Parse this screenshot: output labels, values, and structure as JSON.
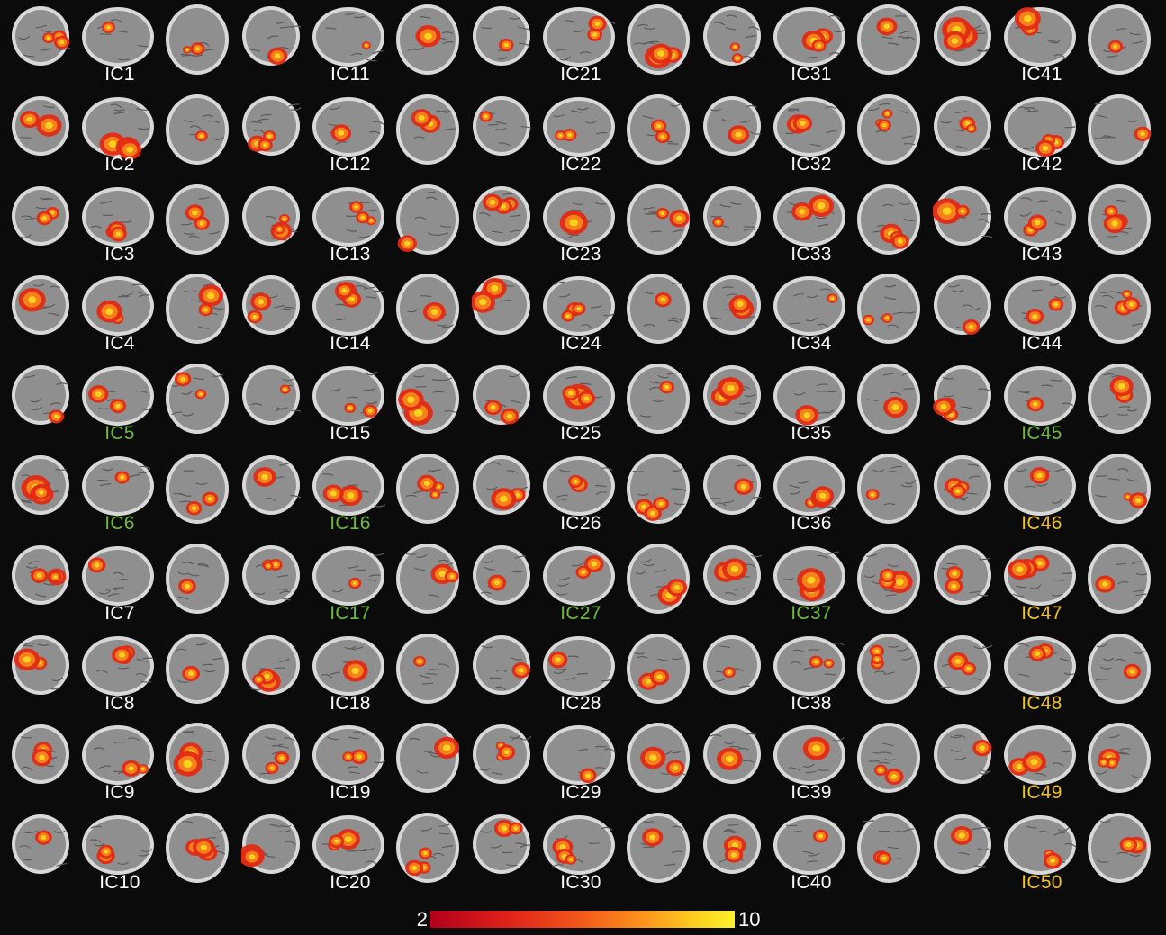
{
  "colors": {
    "background": "#0b0b0b",
    "label_default": "#ffffff",
    "label_green": "#6dbb3c",
    "label_yellow": "#f2c21b",
    "skull": "#d8d8d8",
    "tissue": "#8f8f8f"
  },
  "colorbar": {
    "min": "2",
    "max": "10",
    "colors": [
      "#b3001a",
      "#e0201a",
      "#f25a1a",
      "#ff9a1e",
      "#ffd21e",
      "#fff12a"
    ]
  },
  "components": [
    {
      "label": "IC1",
      "color": "white"
    },
    {
      "label": "IC2",
      "color": "white"
    },
    {
      "label": "IC3",
      "color": "white"
    },
    {
      "label": "IC4",
      "color": "white"
    },
    {
      "label": "IC5",
      "color": "green"
    },
    {
      "label": "IC6",
      "color": "green"
    },
    {
      "label": "IC7",
      "color": "white"
    },
    {
      "label": "IC8",
      "color": "white"
    },
    {
      "label": "IC9",
      "color": "white"
    },
    {
      "label": "IC10",
      "color": "white"
    },
    {
      "label": "IC11",
      "color": "white"
    },
    {
      "label": "IC12",
      "color": "white"
    },
    {
      "label": "IC13",
      "color": "white"
    },
    {
      "label": "IC14",
      "color": "white"
    },
    {
      "label": "IC15",
      "color": "white"
    },
    {
      "label": "IC16",
      "color": "green"
    },
    {
      "label": "IC17",
      "color": "green"
    },
    {
      "label": "IC18",
      "color": "white"
    },
    {
      "label": "IC19",
      "color": "white"
    },
    {
      "label": "IC20",
      "color": "white"
    },
    {
      "label": "IC21",
      "color": "white"
    },
    {
      "label": "IC22",
      "color": "white"
    },
    {
      "label": "IC23",
      "color": "white"
    },
    {
      "label": "IC24",
      "color": "white"
    },
    {
      "label": "IC25",
      "color": "white"
    },
    {
      "label": "IC26",
      "color": "white"
    },
    {
      "label": "IC27",
      "color": "green"
    },
    {
      "label": "IC28",
      "color": "white"
    },
    {
      "label": "IC29",
      "color": "white"
    },
    {
      "label": "IC30",
      "color": "white"
    },
    {
      "label": "IC31",
      "color": "white"
    },
    {
      "label": "IC32",
      "color": "white"
    },
    {
      "label": "IC33",
      "color": "white"
    },
    {
      "label": "IC34",
      "color": "white"
    },
    {
      "label": "IC35",
      "color": "white"
    },
    {
      "label": "IC36",
      "color": "white"
    },
    {
      "label": "IC37",
      "color": "green"
    },
    {
      "label": "IC38",
      "color": "white"
    },
    {
      "label": "IC39",
      "color": "white"
    },
    {
      "label": "IC40",
      "color": "white"
    },
    {
      "label": "IC41",
      "color": "white"
    },
    {
      "label": "IC42",
      "color": "white"
    },
    {
      "label": "IC43",
      "color": "white"
    },
    {
      "label": "IC44",
      "color": "white"
    },
    {
      "label": "IC45",
      "color": "green"
    },
    {
      "label": "IC46",
      "color": "yellow"
    },
    {
      "label": "IC47",
      "color": "yellow"
    },
    {
      "label": "IC48",
      "color": "yellow"
    },
    {
      "label": "IC49",
      "color": "yellow"
    },
    {
      "label": "IC50",
      "color": "yellow"
    }
  ]
}
